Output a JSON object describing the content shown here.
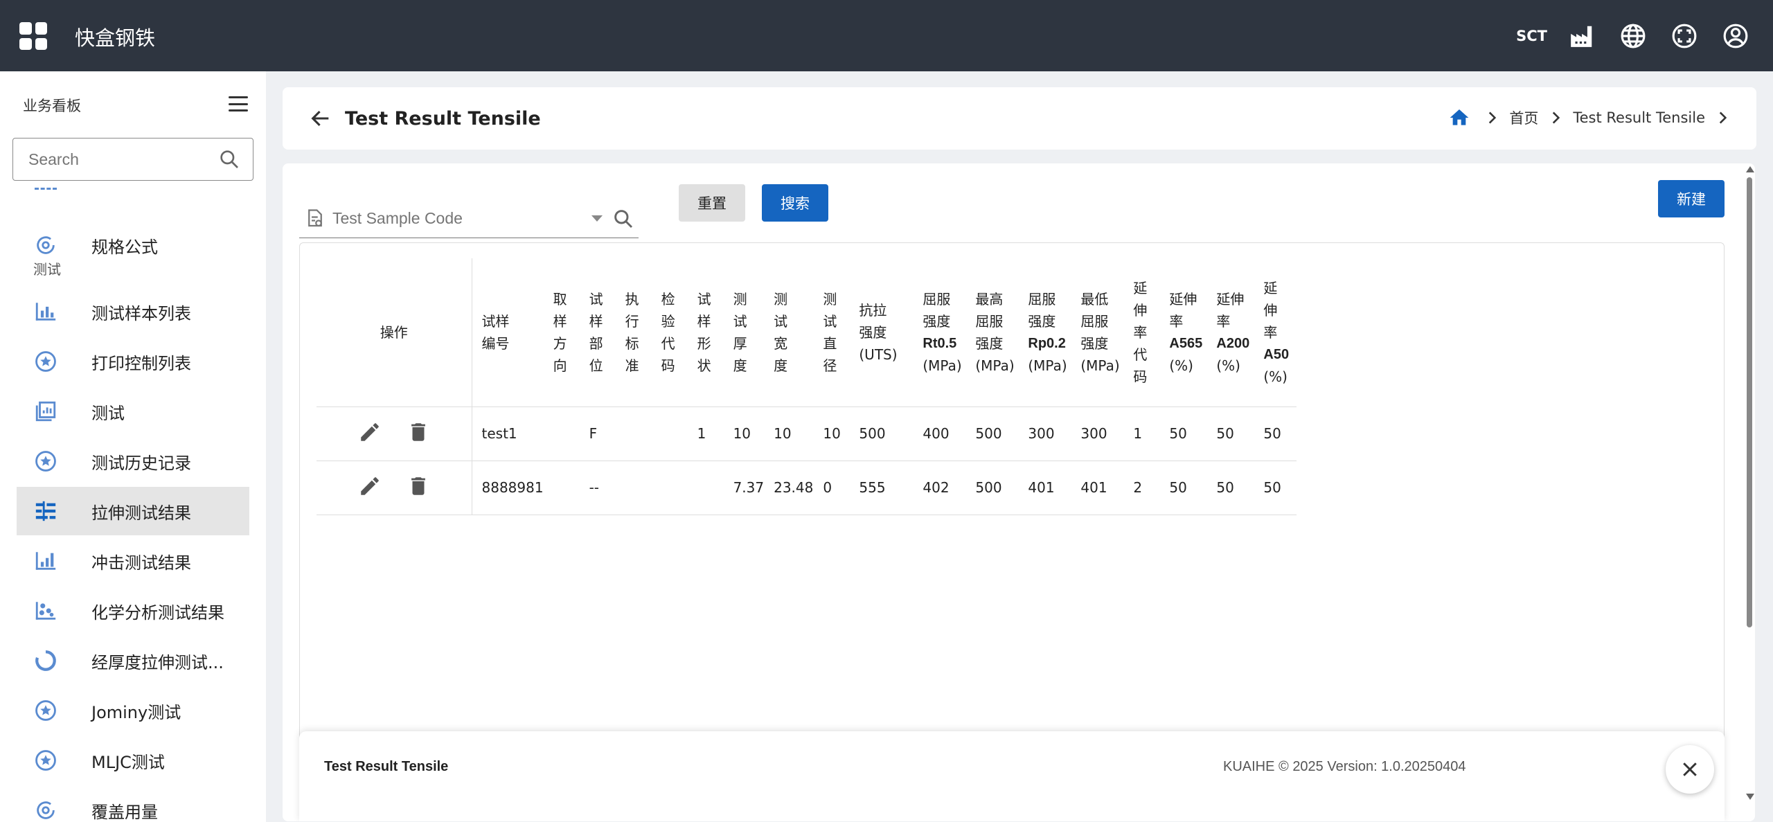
{
  "app": {
    "title": "快盒钢铁",
    "user_code": "SCT"
  },
  "sidebar": {
    "header": "业务看板",
    "search_placeholder": "Search",
    "items": [
      {
        "label": "规格公式",
        "icon": "formula-icon"
      },
      {
        "label": "测试",
        "section": true
      },
      {
        "label": "测试样本列表",
        "icon": "bar-chart-icon"
      },
      {
        "label": "打印控制列表",
        "icon": "star-circle-icon"
      },
      {
        "label": "测试",
        "icon": "chart-box-icon"
      },
      {
        "label": "测试历史记录",
        "icon": "star-circle-icon"
      },
      {
        "label": "拉伸测试结果",
        "icon": "tensile-icon",
        "active": true
      },
      {
        "label": "冲击测试结果",
        "icon": "impact-chart-icon"
      },
      {
        "label": "化学分析测试结果",
        "icon": "scatter-icon"
      },
      {
        "label": "经厚度拉伸测试...",
        "icon": "donut-icon"
      },
      {
        "label": "Jominy测试",
        "icon": "star-circle-icon"
      },
      {
        "label": "MLJC测试",
        "icon": "star-circle-icon"
      },
      {
        "label": "覆盖用量",
        "icon": "formula-icon"
      }
    ]
  },
  "header": {
    "title": "Test Result Tensile",
    "breadcrumb": [
      "首页",
      "Test Result Tensile"
    ]
  },
  "filters": {
    "sample_code_placeholder": "Test Sample Code",
    "reset_label": "重置",
    "search_label": "搜索",
    "new_label": "新建"
  },
  "table": {
    "ops_header": "操作",
    "columns": [
      {
        "lines": [
          "试样",
          "编号"
        ],
        "bold": []
      },
      {
        "lines": [
          "取",
          "样",
          "方",
          "向"
        ],
        "bold": []
      },
      {
        "lines": [
          "试",
          "样",
          "部",
          "位"
        ],
        "bold": []
      },
      {
        "lines": [
          "执",
          "行",
          "标",
          "准"
        ],
        "bold": []
      },
      {
        "lines": [
          "检",
          "验",
          "代",
          "码"
        ],
        "bold": []
      },
      {
        "lines": [
          "试",
          "样",
          "形",
          "状"
        ],
        "bold": []
      },
      {
        "lines": [
          "测",
          "试",
          "厚",
          "度"
        ],
        "bold": []
      },
      {
        "lines": [
          "测",
          "试",
          "宽",
          "度"
        ],
        "bold": []
      },
      {
        "lines": [
          "测",
          "试",
          "直",
          "径"
        ],
        "bold": []
      },
      {
        "lines": [
          "抗拉",
          "强度",
          "(UTS)"
        ],
        "bold": []
      },
      {
        "lines": [
          "屈服",
          "强度",
          "Rt0.5",
          "(MPa)"
        ],
        "bold": [
          2
        ]
      },
      {
        "lines": [
          "最高",
          "屈服",
          "强度",
          "(MPa)"
        ],
        "bold": []
      },
      {
        "lines": [
          "屈服",
          "强度",
          "Rp0.2",
          "(MPa)"
        ],
        "bold": [
          2
        ]
      },
      {
        "lines": [
          "最低",
          "屈服",
          "强度",
          "(MPa)"
        ],
        "bold": []
      },
      {
        "lines": [
          "延",
          "伸",
          "率",
          "代",
          "码"
        ],
        "bold": []
      },
      {
        "lines": [
          "延伸",
          "率",
          "A565",
          "(%)"
        ],
        "bold": [
          2
        ]
      },
      {
        "lines": [
          "延伸",
          "率",
          "A200",
          "(%)"
        ],
        "bold": [
          2
        ]
      },
      {
        "lines": [
          "延",
          "伸",
          "率",
          "A50",
          "(%)"
        ],
        "bold": [
          3
        ]
      }
    ],
    "rows": [
      [
        "test1",
        "",
        "F",
        "",
        "",
        "1",
        "10",
        "10",
        "10",
        "500",
        "400",
        "500",
        "300",
        "300",
        "1",
        "50",
        "50",
        "50"
      ],
      [
        "8888981",
        "",
        "--",
        "",
        "",
        "",
        "7.37",
        "23.48",
        "0",
        "555",
        "402",
        "500",
        "401",
        "401",
        "2",
        "50",
        "50",
        "50"
      ]
    ]
  },
  "footer": {
    "title": "Test Result Tensile",
    "version": "KUAIHE © 2025 Version: 1.0.20250404"
  },
  "colors": {
    "topbar": "#2e3540",
    "primary": "#1565c0",
    "icon_blue": "#5a8bd0",
    "active_bg": "#e5e5e5"
  }
}
